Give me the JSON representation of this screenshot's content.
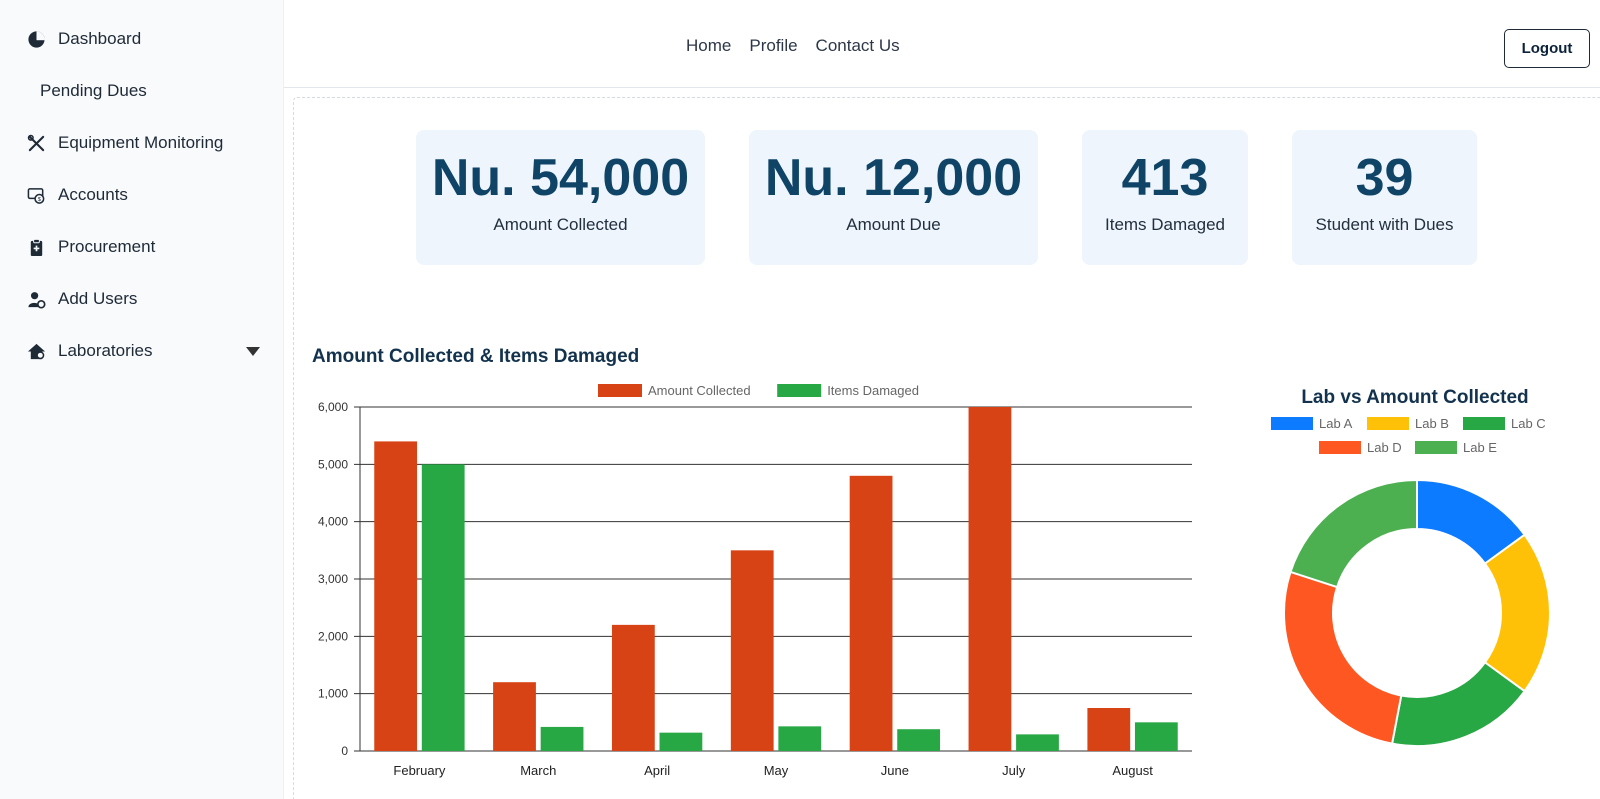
{
  "sidebar": {
    "items": [
      {
        "label": "Dashboard",
        "icon": "pie-chart-icon"
      },
      {
        "label": "Pending Dues",
        "icon": ""
      },
      {
        "label": "Equipment Monitoring",
        "icon": "tools-icon"
      },
      {
        "label": "Accounts",
        "icon": "cash-icon"
      },
      {
        "label": "Procurement",
        "icon": "clipboard-icon"
      },
      {
        "label": "Add Users",
        "icon": "user-gear-icon"
      },
      {
        "label": "Laboratories",
        "icon": "house-gear-icon"
      }
    ]
  },
  "header": {
    "nav": [
      "Home",
      "Profile",
      "Contact Us"
    ],
    "logout_label": "Logout"
  },
  "stats": [
    {
      "value": "Nu. 54,000",
      "label": "Amount Collected"
    },
    {
      "value": "Nu. 12,000",
      "label": "Amount Due"
    },
    {
      "value": "413",
      "label": "Items Damaged"
    },
    {
      "value": "39",
      "label": "Student with Dues"
    }
  ],
  "chart_data": [
    {
      "type": "bar",
      "title": "Amount Collected & Items Damaged",
      "categories": [
        "February",
        "March",
        "April",
        "May",
        "June",
        "July",
        "August"
      ],
      "series": [
        {
          "name": "Amount Collected",
          "color": "#d84315",
          "values": [
            5400,
            1200,
            2200,
            3500,
            4800,
            6000,
            750
          ]
        },
        {
          "name": "Items Damaged",
          "color": "#28a745",
          "values": [
            5000,
            420,
            320,
            430,
            380,
            290,
            500
          ]
        }
      ],
      "ylim": [
        0,
        6000
      ],
      "yticks": [
        "0",
        "1,000",
        "2,000",
        "3,000",
        "4,000",
        "5,000",
        "6,000"
      ],
      "legend": "top",
      "grid": true
    },
    {
      "type": "pie",
      "title": "Lab vs Amount Collected",
      "labels": [
        "Lab A",
        "Lab B",
        "Lab C",
        "Lab D",
        "Lab E"
      ],
      "values": [
        15,
        20,
        18,
        27,
        20
      ],
      "colors": [
        "#0d7bff",
        "#ffc107",
        "#28a745",
        "#ff5722",
        "#4caf50"
      ],
      "legend": "top"
    }
  ]
}
